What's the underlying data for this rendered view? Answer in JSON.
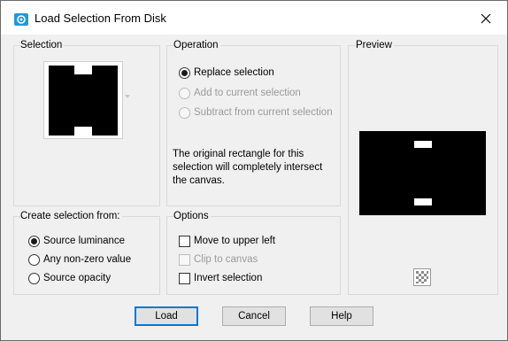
{
  "window": {
    "title": "Load Selection From Disk",
    "accent_color": "#0078d7"
  },
  "selection_group": {
    "label": "Selection",
    "thumbnail_icon": "selection-mask-thumbnail"
  },
  "operation_group": {
    "label": "Operation",
    "options": [
      {
        "label": "Replace selection",
        "checked": true,
        "enabled": true
      },
      {
        "label": "Add to current selection",
        "checked": false,
        "enabled": false
      },
      {
        "label": "Subtract from current selection",
        "checked": false,
        "enabled": false
      }
    ],
    "description": "The original rectangle for this selection will completely intersect the canvas."
  },
  "preview_group": {
    "label": "Preview",
    "toggle_icon": "transparency-checker-icon"
  },
  "create_from_group": {
    "label": "Create selection from:",
    "options": [
      {
        "label": "Source luminance",
        "checked": true
      },
      {
        "label": "Any non-zero value",
        "checked": false
      },
      {
        "label": "Source opacity",
        "checked": false
      }
    ]
  },
  "options_group": {
    "label": "Options",
    "items": [
      {
        "label": "Move to upper left",
        "checked": false,
        "enabled": true
      },
      {
        "label": "Clip to canvas",
        "checked": false,
        "enabled": false
      },
      {
        "label": "Invert selection",
        "checked": false,
        "enabled": true
      }
    ]
  },
  "buttons": {
    "load": "Load",
    "cancel": "Cancel",
    "help": "Help"
  }
}
